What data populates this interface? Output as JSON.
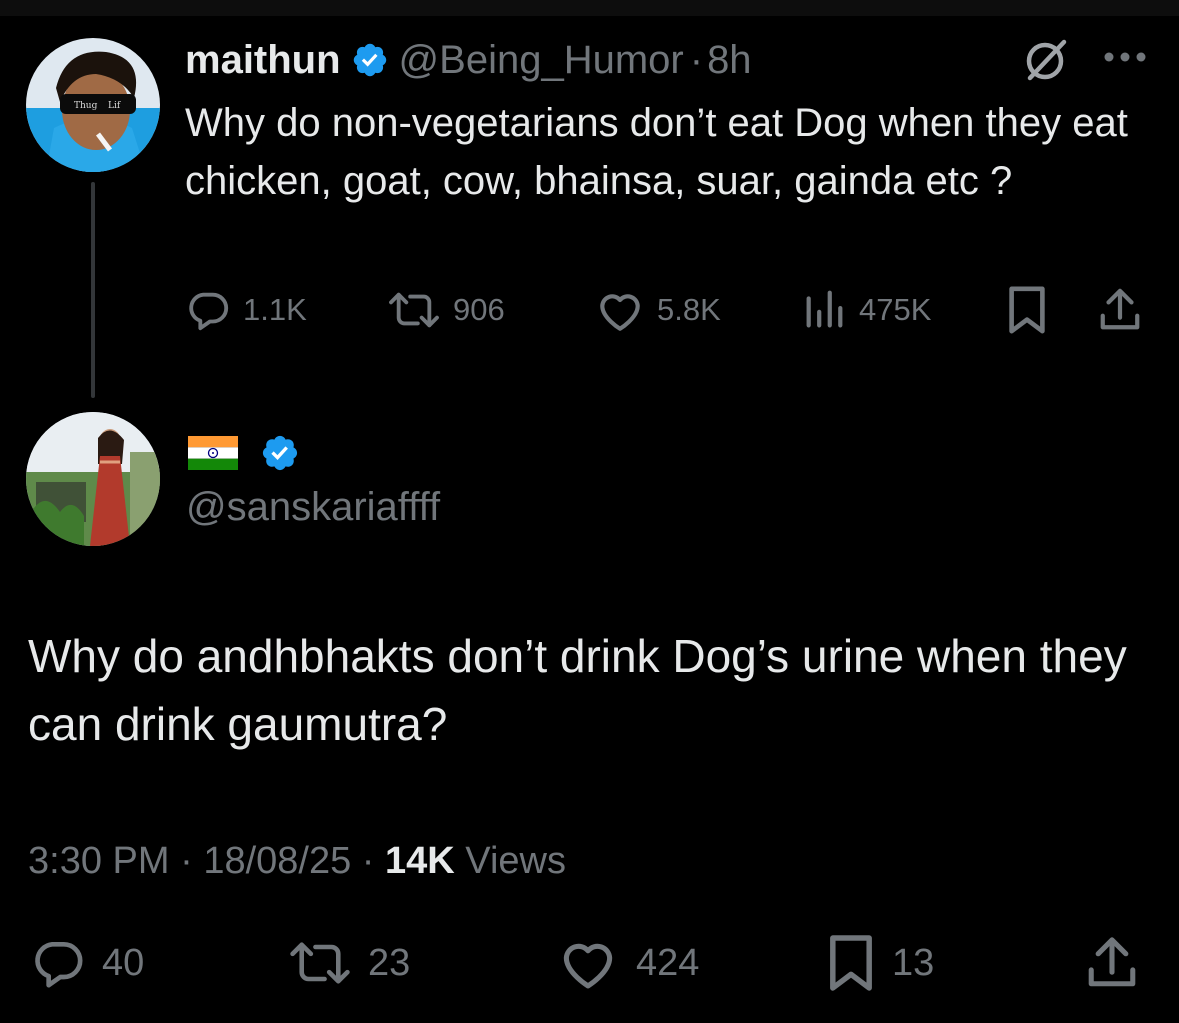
{
  "quoted_tweet": {
    "author_name": "maithun",
    "handle": "@Being_Humor",
    "separator": "·",
    "time": "8h",
    "text": "Why do non-vegetarians don’t eat Dog when they eat chicken, goat, cow, bhainsa, suar, gainda etc ?",
    "avatar_sunglasses_text_left": "Thug",
    "avatar_sunglasses_text_right": "Lif",
    "stats": {
      "replies": "1.1K",
      "reposts": "906",
      "likes": "5.8K",
      "views": "475K"
    },
    "icons": [
      "verified-badge-icon",
      "grok-icon",
      "more-icon",
      "reply-icon",
      "repost-icon",
      "like-icon",
      "views-icon",
      "bookmark-icon",
      "share-icon"
    ]
  },
  "reply_tweet": {
    "display_name_flag": "india-flag-icon",
    "handle": "@sanskariaffff",
    "text": "Why do andhbhakts don’t drink Dog’s urine when they can drink gaumutra?",
    "meta": {
      "time": "3:30 PM",
      "separator": "·",
      "date": "18/08/25",
      "views_count": "14K",
      "views_label": "Views"
    },
    "stats": {
      "replies": "40",
      "reposts": "23",
      "likes": "424",
      "bookmarks": "13"
    }
  },
  "colors": {
    "background": "#000000",
    "text": "#e7e9ea",
    "secondary": "#71767b",
    "verified": "#1d9bf0",
    "thread_line": "#333639"
  }
}
